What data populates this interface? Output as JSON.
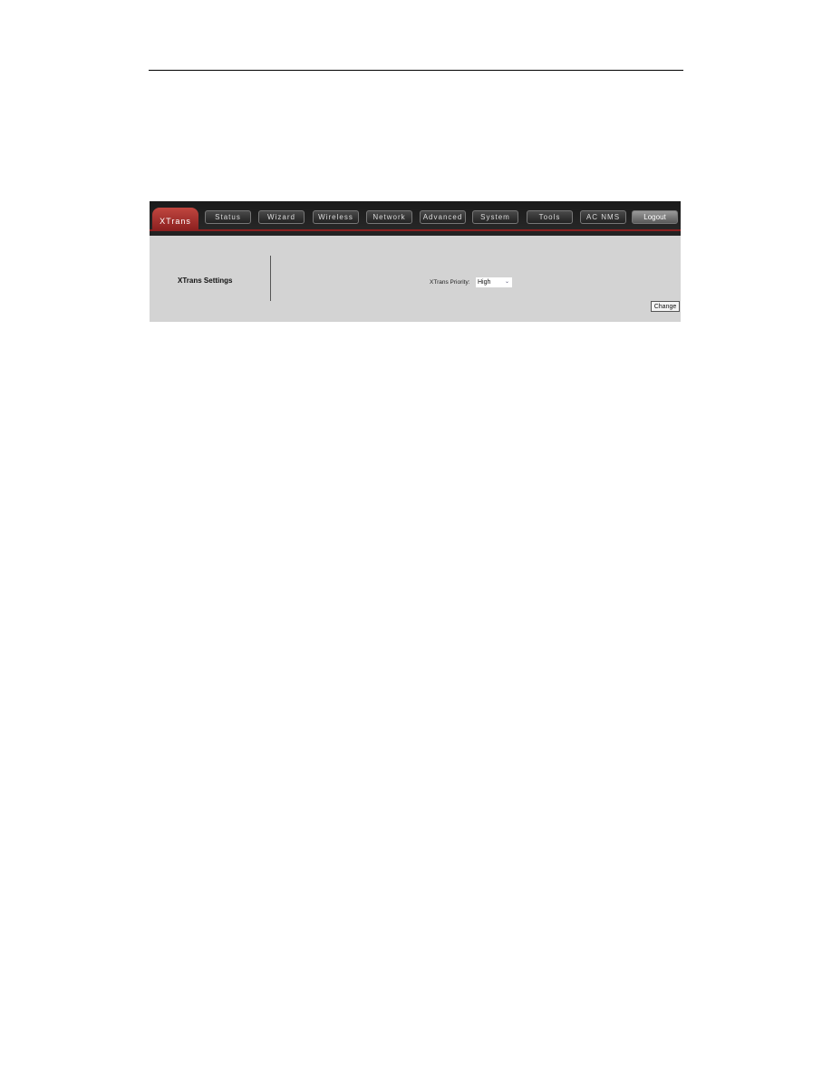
{
  "nav": {
    "tabs": [
      {
        "label": "XTrans",
        "active": true
      },
      {
        "label": "Status"
      },
      {
        "label": "Wizard"
      },
      {
        "label": "Wireless"
      },
      {
        "label": "Network"
      },
      {
        "label": "Advanced"
      },
      {
        "label": "System"
      },
      {
        "label": "Tools"
      },
      {
        "label": "AC NMS"
      },
      {
        "label": "Logout"
      }
    ],
    "accent_color": "#8a1f1f"
  },
  "section": {
    "title": "XTrans Settings"
  },
  "form": {
    "priority_label": "XTrans Priority:",
    "priority_value": "High",
    "submit_label": "Change"
  }
}
